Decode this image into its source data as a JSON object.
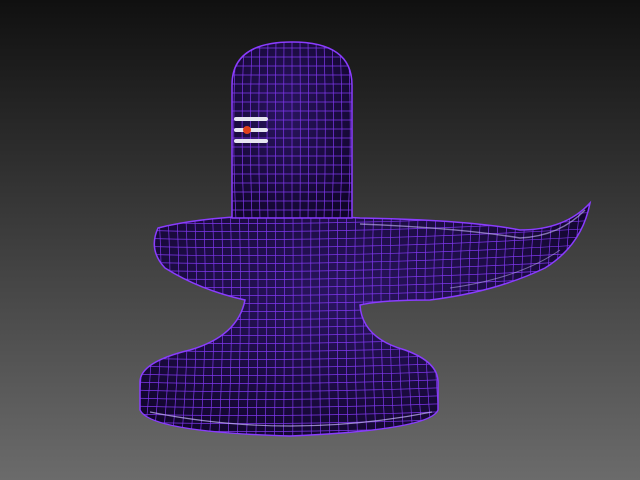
{
  "viewport": {
    "kind": "3d-perspective-viewport",
    "background_top": "#101010",
    "background_bottom": "#6b6b6b"
  },
  "model": {
    "object": "shiva-lingam",
    "display_mode": "wireframe-over-shaded",
    "surface_color": "#1a0a3d",
    "wire_color": "#8a3cff",
    "edge_highlight": "#c9b8ff",
    "tilak_stripe_color": "#e6e6f0",
    "tilak_dot_color": "#e0401a",
    "tilak_stripe_count": 3
  }
}
